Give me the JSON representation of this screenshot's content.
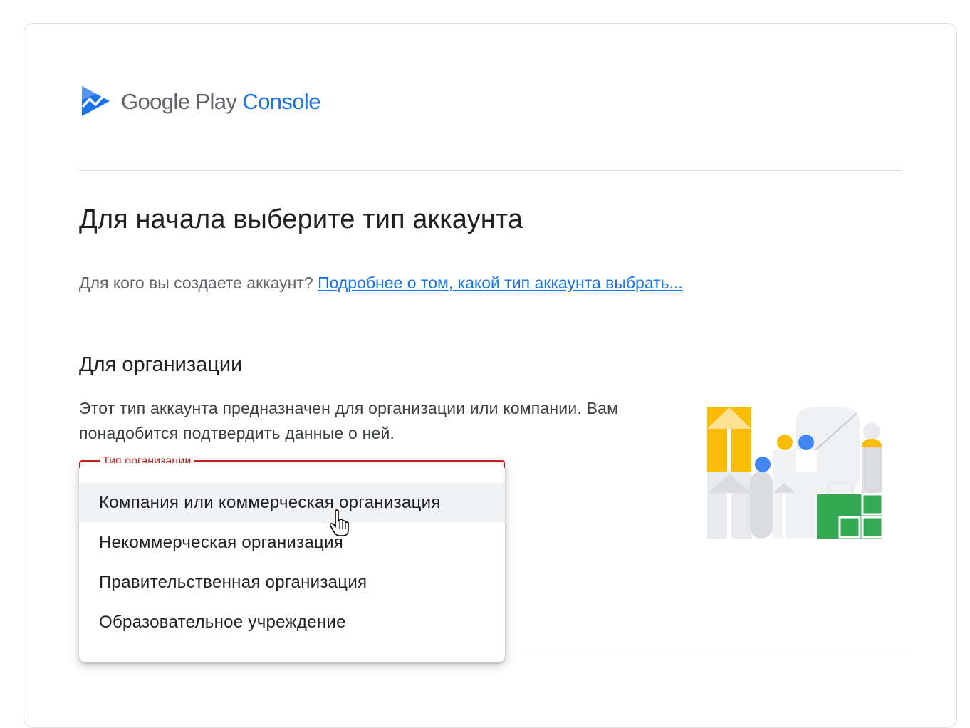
{
  "logo": {
    "google_play": "Google Play",
    "console": "Console",
    "icon": "play-console-icon"
  },
  "page": {
    "title": "Для начала выберите тип аккаунта",
    "question": "Для кого вы создаете аккаунт?",
    "help_link": "Подробнее о том, какой тип аккаунта выбрать..."
  },
  "organization": {
    "title": "Для организации",
    "description": "Этот тип аккаунта предназначен для организации или компании. Вам понадобится подтвердить данные о ней.",
    "field_label": "Тип организации",
    "options": [
      "Компания или коммерческая организация",
      "Некоммерческая организация",
      "Правительственная организация",
      "Образовательное учреждение"
    ],
    "hovered_option_index": 0,
    "illustration": "organization-illustration"
  },
  "colors": {
    "accent": "#1a73e8",
    "error": "#c5221f",
    "yellow": "#fbbc04",
    "blue": "#4285f4",
    "green": "#34a853"
  }
}
